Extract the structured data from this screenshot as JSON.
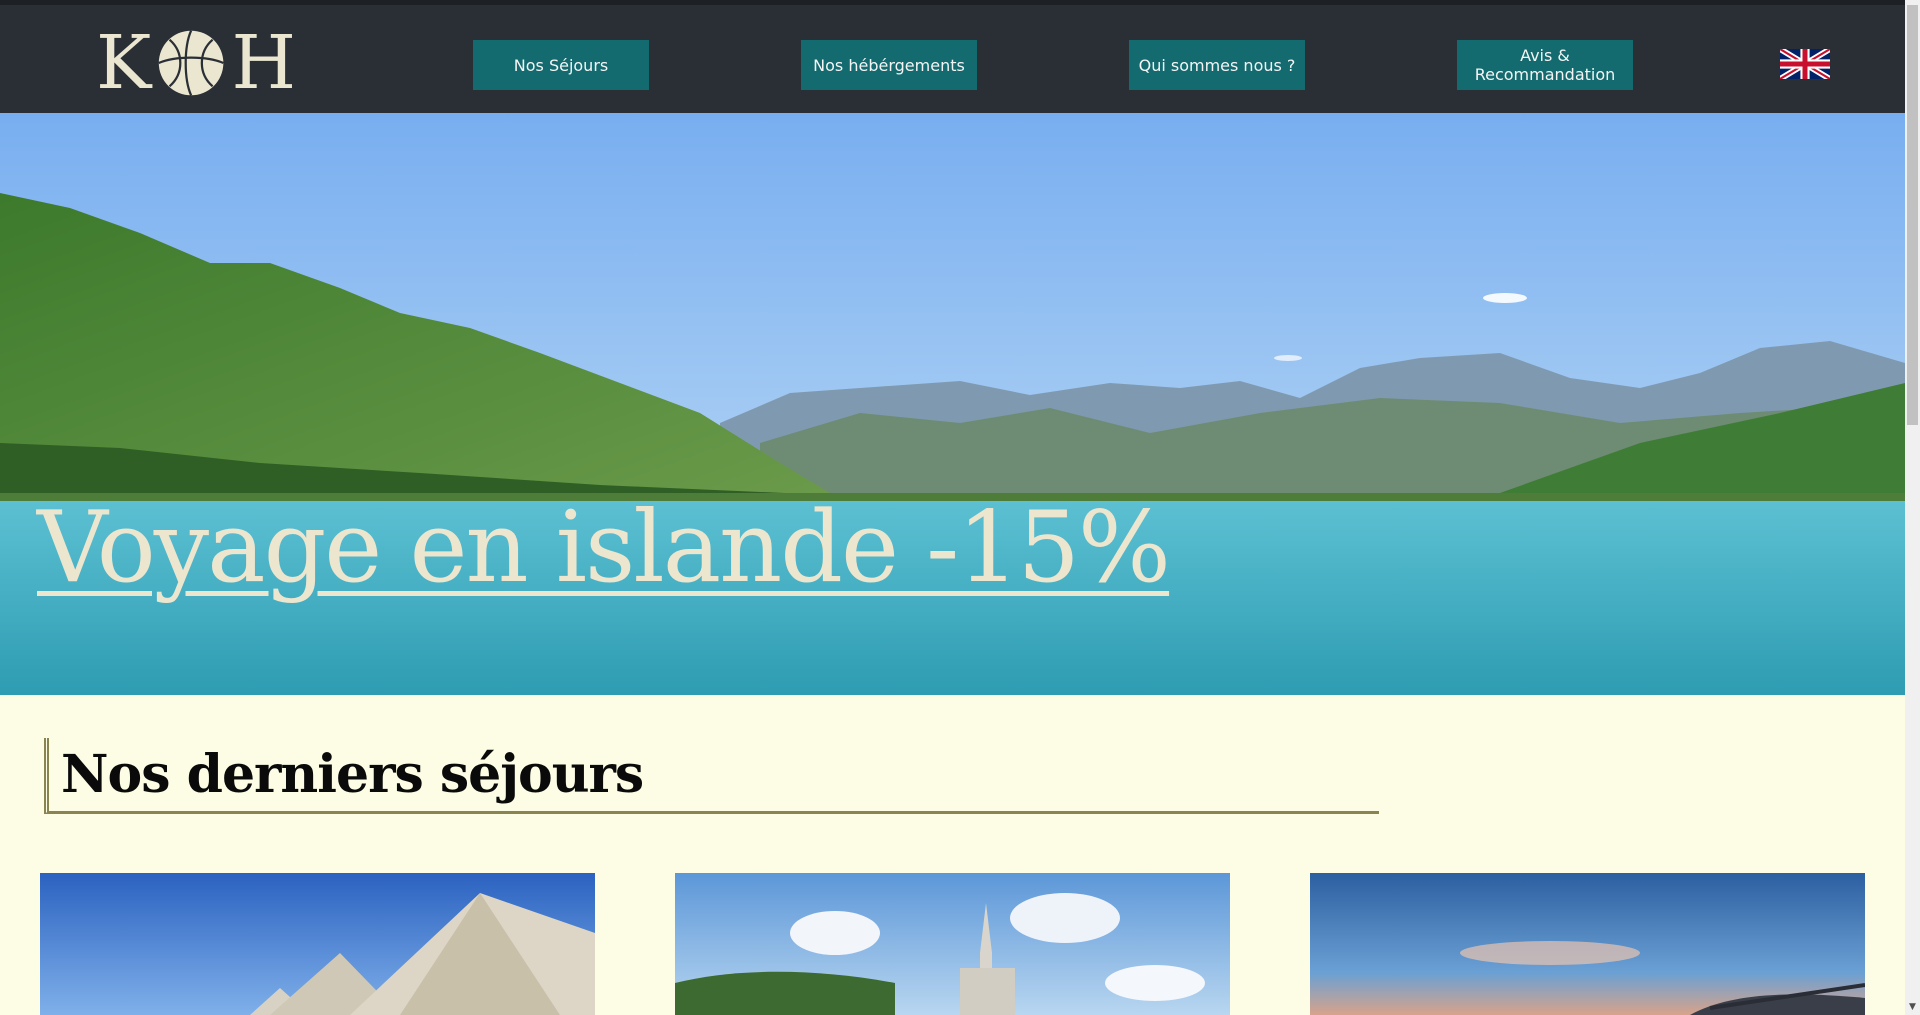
{
  "header": {
    "logo": {
      "left": "K",
      "right": "H"
    },
    "nav": [
      {
        "label": "Nos Séjours"
      },
      {
        "label": "Nos hébérgements"
      },
      {
        "label": "Qui sommes nous ?"
      },
      {
        "label": "Avis & Recommandation"
      }
    ],
    "language_icon": "uk-flag-icon"
  },
  "hero": {
    "title": "Voyage en islande -15%"
  },
  "section": {
    "title": "Nos derniers séjours"
  },
  "colors": {
    "navbar": "#2a2f36",
    "nav_button": "#136b70",
    "page_background": "#fdfde6",
    "accent_line": "#8a8550"
  }
}
